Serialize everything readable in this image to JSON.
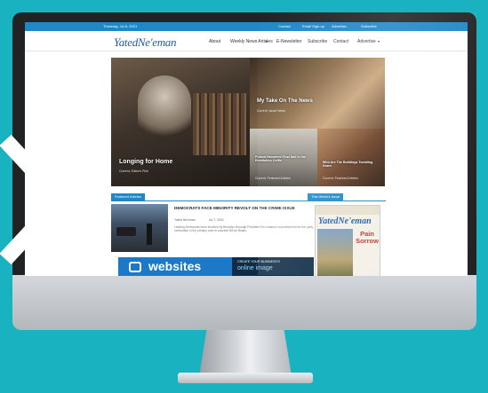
{
  "topbar": {
    "date": "Thursday, Jul 6, 2021",
    "links": [
      "Contact",
      "Email Sign-up",
      "Advertise",
      "Subscribe"
    ]
  },
  "nav": {
    "logo": "YatedNe'eman",
    "items": [
      "About",
      "Weekly News Articles",
      "E-Newsletter",
      "Subscribe",
      "Contact",
      "Advertise"
    ]
  },
  "hero": {
    "main": {
      "title": "Longing for Home",
      "meta": "Current, Editor's Pick"
    },
    "top_right": {
      "title": "My Take On The News",
      "meta": "Current, Israel News"
    },
    "bottom_mid": {
      "title": "Poland Hammers Final Nail in the Restitution Coffin",
      "meta": "Current, Featured Articles"
    },
    "bottom_right": {
      "title": "Who Are The Buildings Tumbling Down",
      "meta": "Current, Featured Articles"
    }
  },
  "featured": {
    "section_label": "Featured Articles",
    "headline": "DEMOCRATS FACE MINORITY REVOLT ON THE CRIME ISSUE",
    "author": "Yated Ne'eman",
    "date": "Jul 7, 2021",
    "excerpt": "Leading Democrats were shocked by Brooklyn Borough President Eric Adams's successful bid for the party nomination in the primary race to succeed Bill de Blasio."
  },
  "ad": {
    "headline": "websites",
    "line1": "CREATE YOUR BUSINESS'S",
    "line2": "online image"
  },
  "sidebar": {
    "section_label": "This Week's Issue",
    "magazine_name": "YatedNe'eman",
    "cover_headline": "Pain Sorrow"
  }
}
